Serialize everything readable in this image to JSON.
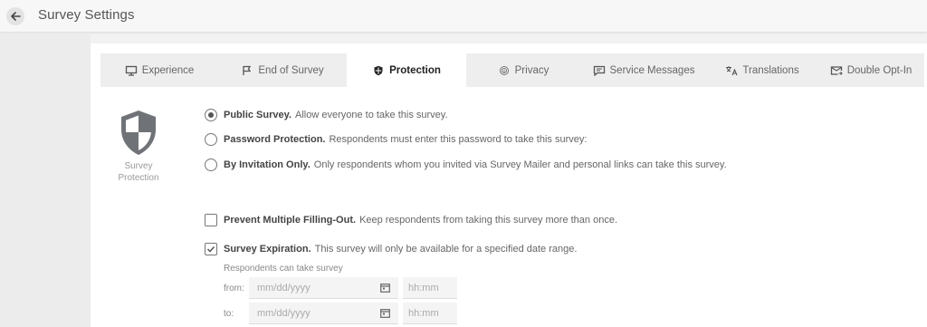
{
  "header": {
    "title": "Survey Settings"
  },
  "tabs": [
    {
      "label": "Experience",
      "icon": "monitor-icon"
    },
    {
      "label": "End of Survey",
      "icon": "flag-icon"
    },
    {
      "label": "Protection",
      "icon": "shield-icon",
      "active": true
    },
    {
      "label": "Privacy",
      "icon": "fingerprint-icon"
    },
    {
      "label": "Service Messages",
      "icon": "message-icon"
    },
    {
      "label": "Translations",
      "icon": "translate-icon"
    },
    {
      "label": "Double Opt-In",
      "icon": "mail-forward-icon"
    }
  ],
  "protection": {
    "label": "Survey Protection",
    "options": [
      {
        "title": "Public Survey.",
        "desc": "Allow everyone to take this survey.",
        "checked": true
      },
      {
        "title": "Password Protection.",
        "desc": "Respondents must enter this password to take this survey:",
        "checked": false
      },
      {
        "title": "By Invitation Only.",
        "desc": "Only respondents whom you invited via Survey Mailer and personal links can take this survey.",
        "checked": false
      }
    ]
  },
  "multiple": {
    "title": "Prevent Multiple Filling-Out.",
    "desc": "Keep respondents from taking this survey more than once.",
    "checked": false
  },
  "expiration": {
    "title": "Survey Expiration.",
    "desc": "This survey will only be available for a specified date range.",
    "checked": true,
    "sub_label": "Respondents can take survey",
    "from_label": "from:",
    "to_label": "to:",
    "date_placeholder": "mm/dd/yyyy",
    "time_placeholder": "hh:mm"
  },
  "colors": {
    "accent": "#555555",
    "tab_bg": "#eeeeee",
    "card_bg": "#ffffff",
    "page_bg": "#f2f2f2"
  }
}
